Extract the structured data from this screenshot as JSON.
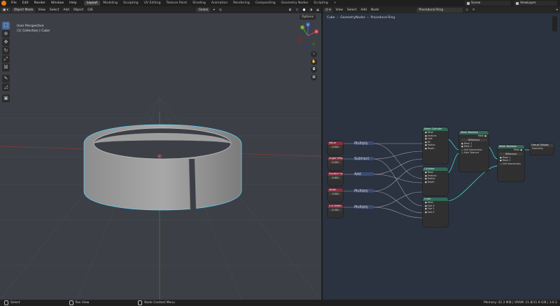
{
  "topbar": {
    "menus": [
      "File",
      "Edit",
      "Render",
      "Window",
      "Help"
    ],
    "workspaces": [
      "Layout",
      "Modeling",
      "Sculpting",
      "UV Editing",
      "Texture Paint",
      "Shading",
      "Animation",
      "Rendering",
      "Compositing",
      "Geometry Nodes",
      "Scripting"
    ],
    "active_workspace": "Layout",
    "add_tab": "+",
    "scene": "Scene",
    "view_layer": "ViewLayer"
  },
  "viewport": {
    "mode": "Object Mode",
    "menus": [
      "View",
      "Select",
      "Add",
      "Object",
      "GIS"
    ],
    "orientation": "Global",
    "info_line1": "User Perspective",
    "info_line2": "(1) Collection | Cube",
    "options_label": "Options",
    "gizmo": {
      "x": "X",
      "y": "Y",
      "z": "Z"
    }
  },
  "node_editor": {
    "menus": [
      "View",
      "Select",
      "Add",
      "Node"
    ],
    "node_group": "Procedural Ring",
    "breadcrumbs": [
      "Cube",
      "GeometryNodes",
      "Procedural Ring"
    ],
    "nodes": {
      "input_nodes": [
        "Value",
        "Angle Offset",
        "Equator Value",
        "Width",
        "Cut Width"
      ],
      "value_fields": [
        "0.500",
        "0.200",
        "0.600",
        "1.000",
        "0.150"
      ],
      "math_ops": [
        "Multiply",
        "Subtract",
        "Add",
        "Multiply",
        "Multiply"
      ],
      "cyl1": "Mesh Cylinder",
      "cyl2": "Cylinder",
      "cube": "Cube",
      "bool1": "Mesh Boolean",
      "bool2": "Mesh Boolean",
      "output": "Group Output",
      "output_socket": "Geometry",
      "difference": "Difference"
    }
  },
  "statusbar": {
    "select": "Select",
    "pan": "Pan View",
    "context": "Node Context Menu",
    "memory": "Memory: 42.3 MiB | VRAM: 11.8/11.9 GiB | 3.6.2"
  },
  "colors": {
    "accent_orange": "#e87d0d",
    "active_tab": "#3d3d3d",
    "node_wire_green": "#3fc7a4"
  }
}
